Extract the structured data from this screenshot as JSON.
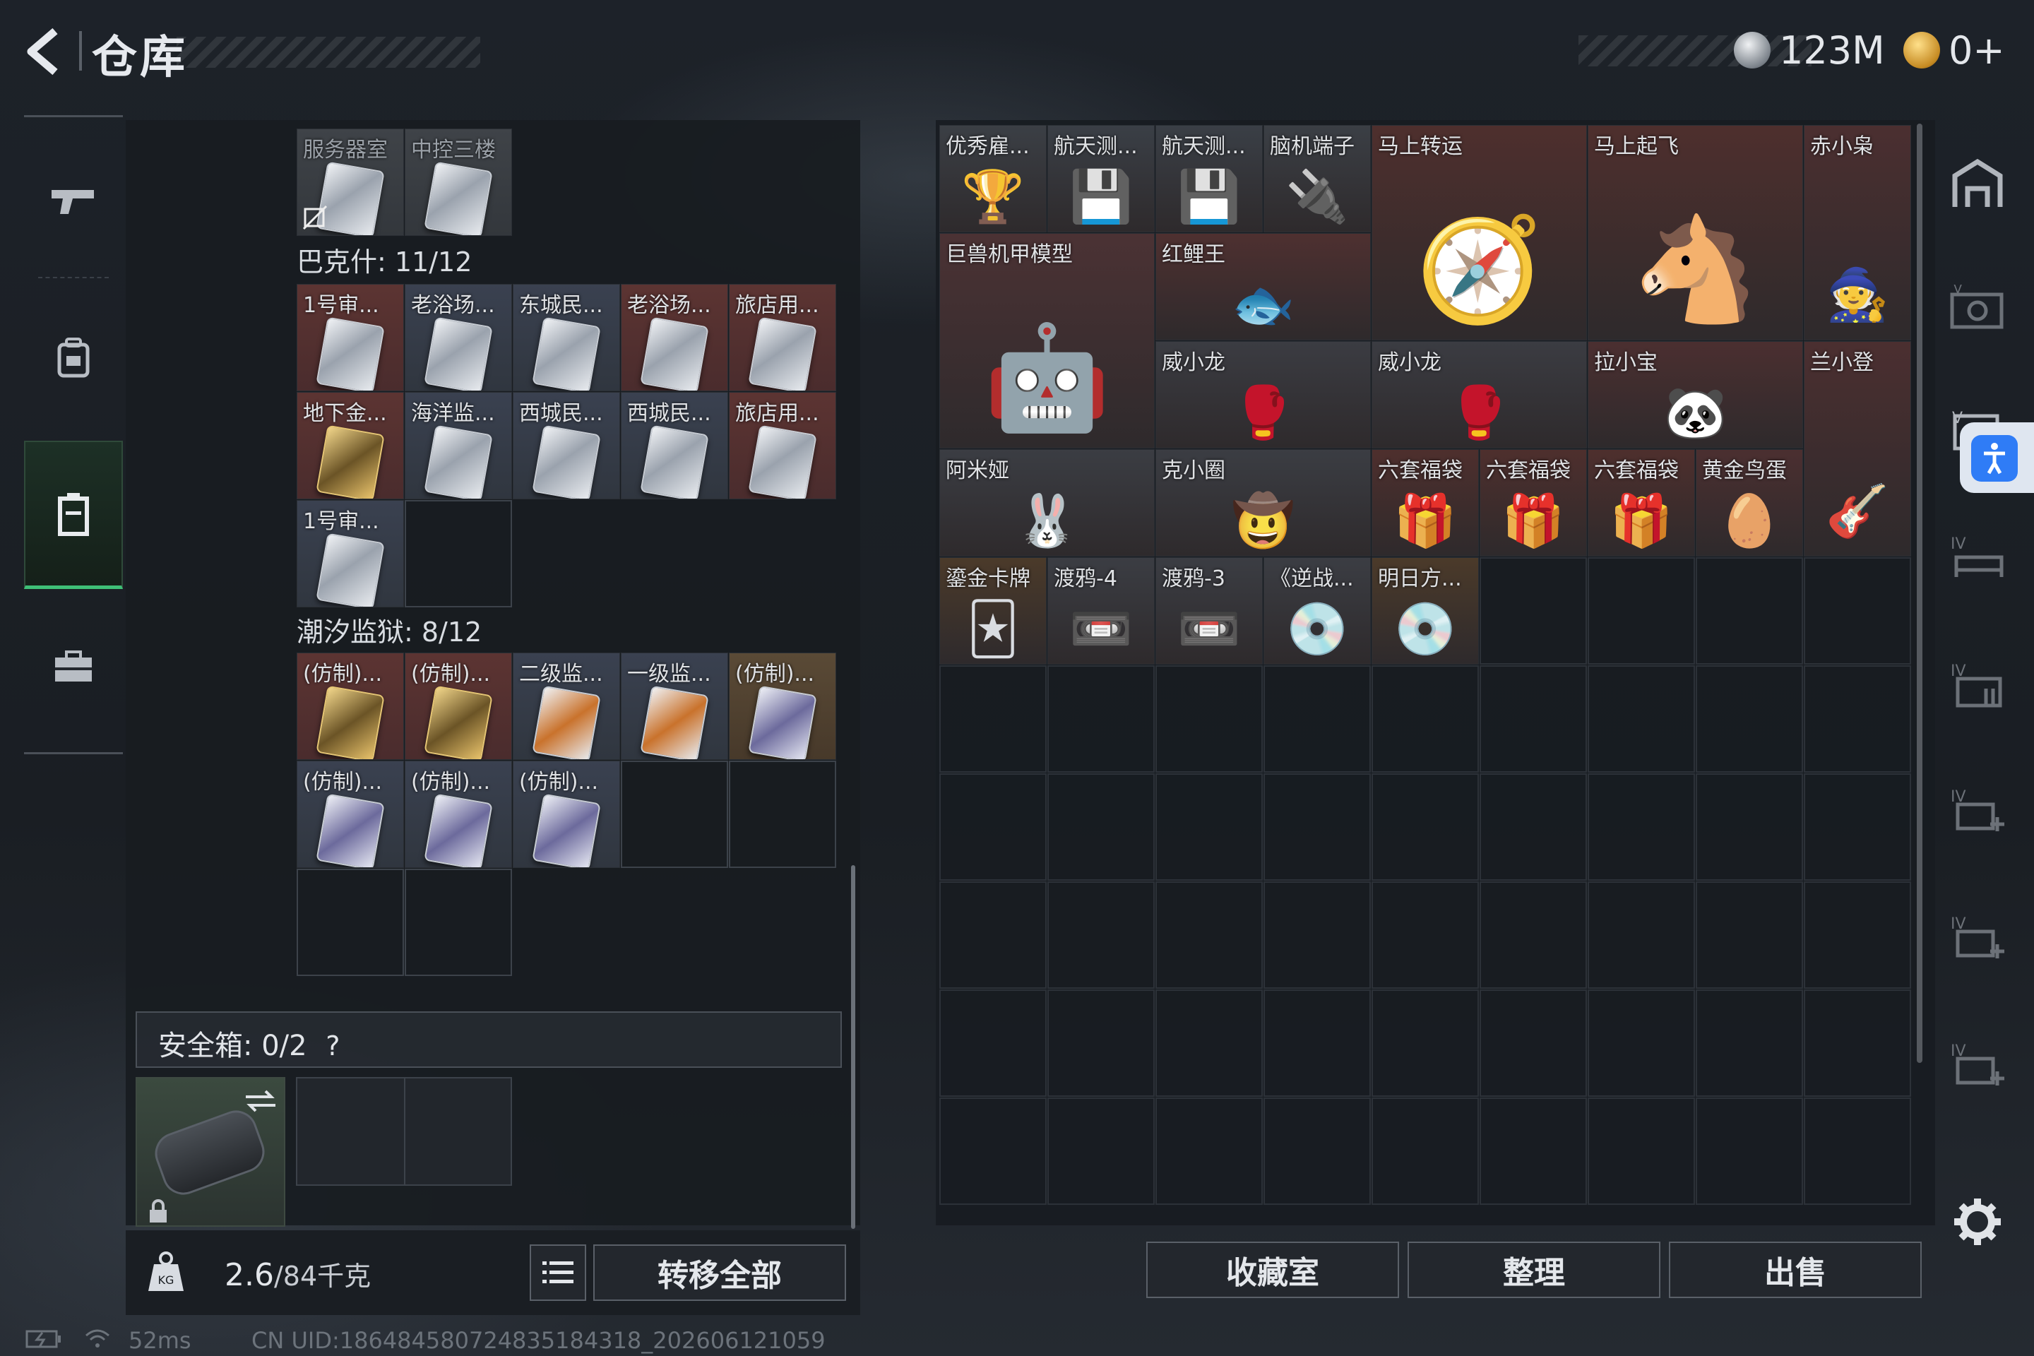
{
  "header": {
    "title": "仓库",
    "currency_1": "123M",
    "currency_2": "0+"
  },
  "left": {
    "top_items": [
      {
        "label": "服务器室"
      },
      {
        "label": "中控三楼"
      }
    ],
    "section_1": {
      "label": "巴克什: 11/12",
      "items": [
        {
          "label": "1号审...",
          "color": "red"
        },
        {
          "label": "老浴场...",
          "color": "blue"
        },
        {
          "label": "东城民...",
          "color": "blue"
        },
        {
          "label": "老浴场...",
          "color": "red"
        },
        {
          "label": "旅店用...",
          "color": "red"
        },
        {
          "label": "地下金...",
          "color": "red"
        },
        {
          "label": "海洋监...",
          "color": "blue"
        },
        {
          "label": "西城民...",
          "color": "blue"
        },
        {
          "label": "西城民...",
          "color": "blue"
        },
        {
          "label": "旅店用...",
          "color": "red"
        },
        {
          "label": "1号审...",
          "color": "blue"
        }
      ]
    },
    "section_2": {
      "label": "潮汐监狱: 8/12",
      "items": [
        {
          "label": "(仿制)...",
          "color": "red"
        },
        {
          "label": "(仿制)...",
          "color": "red"
        },
        {
          "label": "二级监...",
          "color": "blue"
        },
        {
          "label": "一级监...",
          "color": "blue"
        },
        {
          "label": "(仿制)...",
          "color": "gold"
        },
        {
          "label": "(仿制)...",
          "color": "blue"
        },
        {
          "label": "(仿制)...",
          "color": "blue"
        },
        {
          "label": "(仿制)...",
          "color": "blue"
        }
      ]
    },
    "safe_box": {
      "label": "安全箱:",
      "count": "0/2",
      "help": "?"
    },
    "weight": {
      "current": "2.6",
      "max": "/84千克"
    },
    "transfer_all": "转移全部"
  },
  "right": {
    "items": [
      {
        "label": "优秀雇..."
      },
      {
        "label": "航天测..."
      },
      {
        "label": "航天测..."
      },
      {
        "label": "脑机端子"
      },
      {
        "label": "马上转运"
      },
      {
        "label": "马上起飞"
      },
      {
        "label": "赤小枭"
      },
      {
        "label": "巨兽机甲模型"
      },
      {
        "label": "红鲤王"
      },
      {
        "label": "威小龙"
      },
      {
        "label": "威小龙"
      },
      {
        "label": "拉小宝"
      },
      {
        "label": "兰小登"
      },
      {
        "label": "阿米娅"
      },
      {
        "label": "克小圈"
      },
      {
        "label": "六套福袋"
      },
      {
        "label": "六套福袋"
      },
      {
        "label": "六套福袋"
      },
      {
        "label": "黄金鸟蛋"
      },
      {
        "label": "鎏金卡牌"
      },
      {
        "label": "渡鸦-4"
      },
      {
        "label": "渡鸦-3"
      },
      {
        "label": "《逆战..."
      },
      {
        "label": "明日方..."
      }
    ],
    "buttons": {
      "collection": "收藏室",
      "organize": "整理",
      "sell": "出售"
    }
  },
  "footer": {
    "ping": "52ms",
    "uid": "CN UID:18648458072483518431​8_202606121059"
  }
}
